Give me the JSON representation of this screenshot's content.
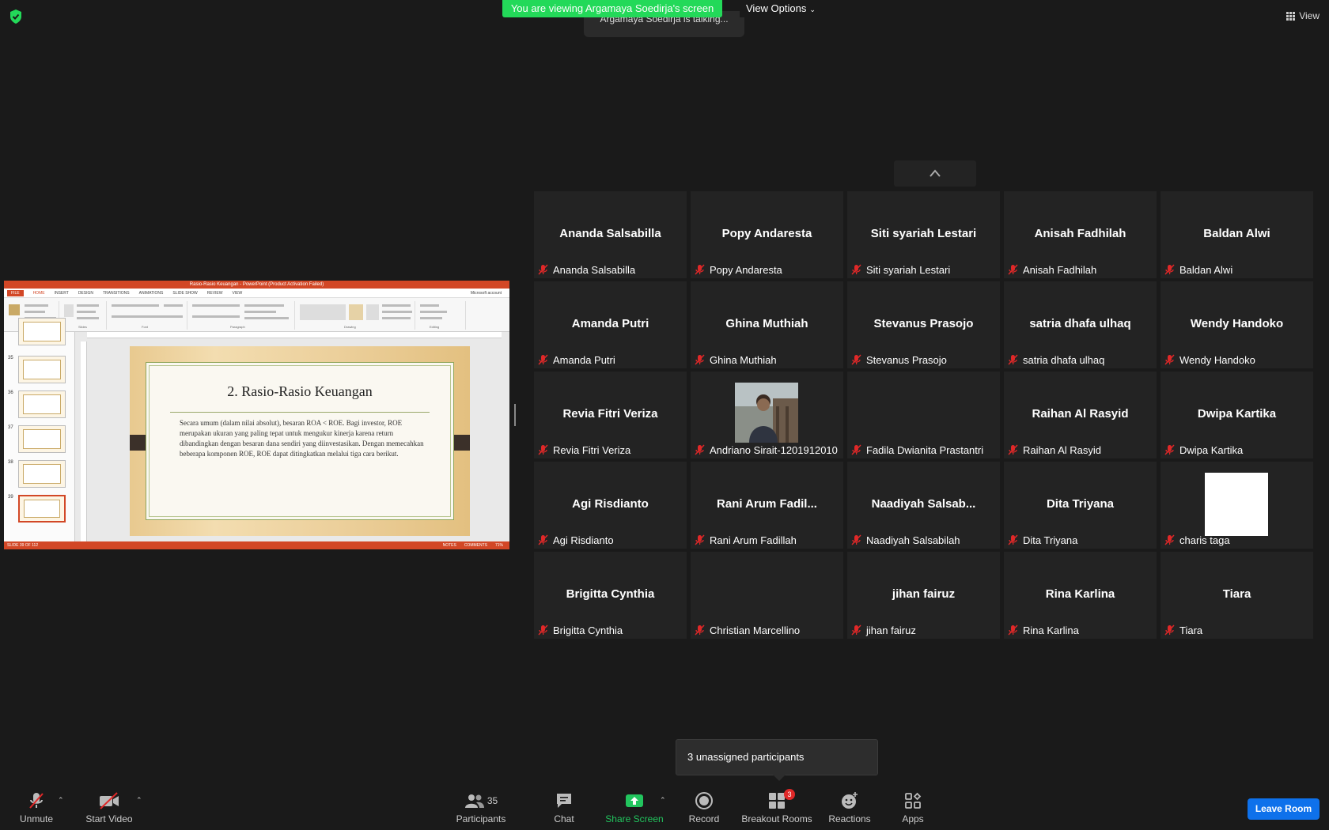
{
  "top": {
    "banner": "You are viewing Argamaya Soedirja's screen",
    "view_options": "View Options",
    "talking": "Argamaya Soedirja is talking...",
    "view": "View"
  },
  "shared_screen": {
    "window_title": "Rasio-Rasio Keuangan - PowerPoint (Product Activation Failed)",
    "tabs": [
      "FILE",
      "HOME",
      "INSERT",
      "DESIGN",
      "TRANSITIONS",
      "ANIMATIONS",
      "SLIDE SHOW",
      "REVIEW",
      "VIEW"
    ],
    "account": "Microsoft account",
    "ribbon_groups": [
      "Clipboard",
      "Slides",
      "Font",
      "Paragraph",
      "Drawing",
      "Editing"
    ],
    "thumb_numbers": [
      "35",
      "36",
      "37",
      "38",
      "39"
    ],
    "slide_title": "2.  Rasio-Rasio Keuangan",
    "slide_text": "Secara umum (dalam nilai absolut), besaran ROA < ROE. Bagi investor, ROE merupakan ukuran yang paling tepat untuk mengukur kinerja karena return dibandingkan dengan besaran dana sendiri yang diinvestasikan. Dengan memecahkan beberapa komponen ROE, ROE dapat ditingkatkan melalui tiga cara berikut.",
    "status_slide": "SLIDE 39 OF 112",
    "status_notes": "NOTES",
    "status_comments": "COMMENTS",
    "zoom": "71%"
  },
  "participants": [
    {
      "name": "Ananda Salsabilla",
      "label": "Ananda Salsabilla"
    },
    {
      "name": "Popy Andaresta",
      "label": "Popy Andaresta"
    },
    {
      "name": "Siti syariah Lestari",
      "label": "Siti syariah Lestari"
    },
    {
      "name": "Anisah Fadhilah",
      "label": "Anisah Fadhilah"
    },
    {
      "name": "Baldan Alwi",
      "label": "Baldan Alwi"
    },
    {
      "name": "Amanda Putri",
      "label": "Amanda Putri"
    },
    {
      "name": "Ghina Muthiah",
      "label": "Ghina Muthiah"
    },
    {
      "name": "Stevanus Prasojo",
      "label": "Stevanus Prasojo"
    },
    {
      "name": "satria dhafa ulhaq",
      "label": "satria dhafa ulhaq"
    },
    {
      "name": "Wendy Handoko",
      "label": "Wendy Handoko"
    },
    {
      "name": "Revia Fitri Veriza",
      "label": "Revia Fitri Veriza"
    },
    {
      "name": "",
      "label": "Andriano Sirait-1201912010",
      "video": "photo"
    },
    {
      "name": "",
      "label": "Fadila Dwianita Prastantri"
    },
    {
      "name": "Raihan Al Rasyid",
      "label": "Raihan Al Rasyid"
    },
    {
      "name": "Dwipa Kartika",
      "label": "Dwipa Kartika"
    },
    {
      "name": "Agi Risdianto",
      "label": "Agi Risdianto"
    },
    {
      "name": "Rani  Arum  Fadil...",
      "label": "Rani Arum Fadillah"
    },
    {
      "name": "Naadiyah  Salsab...",
      "label": "Naadiyah Salsabilah"
    },
    {
      "name": "Dita Triyana",
      "label": "Dita Triyana"
    },
    {
      "name": "",
      "label": "charis taga",
      "video": "white"
    },
    {
      "name": "Brigitta Cynthia",
      "label": "Brigitta Cynthia"
    },
    {
      "name": "",
      "label": "Christian Marcellino"
    },
    {
      "name": "jihan fairuz",
      "label": "jihan fairuz"
    },
    {
      "name": "Rina Karlina",
      "label": "Rina Karlina"
    },
    {
      "name": "Tiara",
      "label": "Tiara"
    }
  ],
  "tooltip": "3 unassigned participants",
  "toolbar": {
    "unmute": "Unmute",
    "start_video": "Start Video",
    "participants": "Participants",
    "participants_count": "35",
    "chat": "Chat",
    "share_screen": "Share Screen",
    "record": "Record",
    "breakout_rooms": "Breakout Rooms",
    "breakout_badge": "3",
    "reactions": "Reactions",
    "apps": "Apps",
    "leave_room": "Leave Room"
  },
  "colors": {
    "banner": "#23d959",
    "muted_mic": "#e02828",
    "leave": "#0e71eb",
    "powerpoint": "#d24726"
  }
}
